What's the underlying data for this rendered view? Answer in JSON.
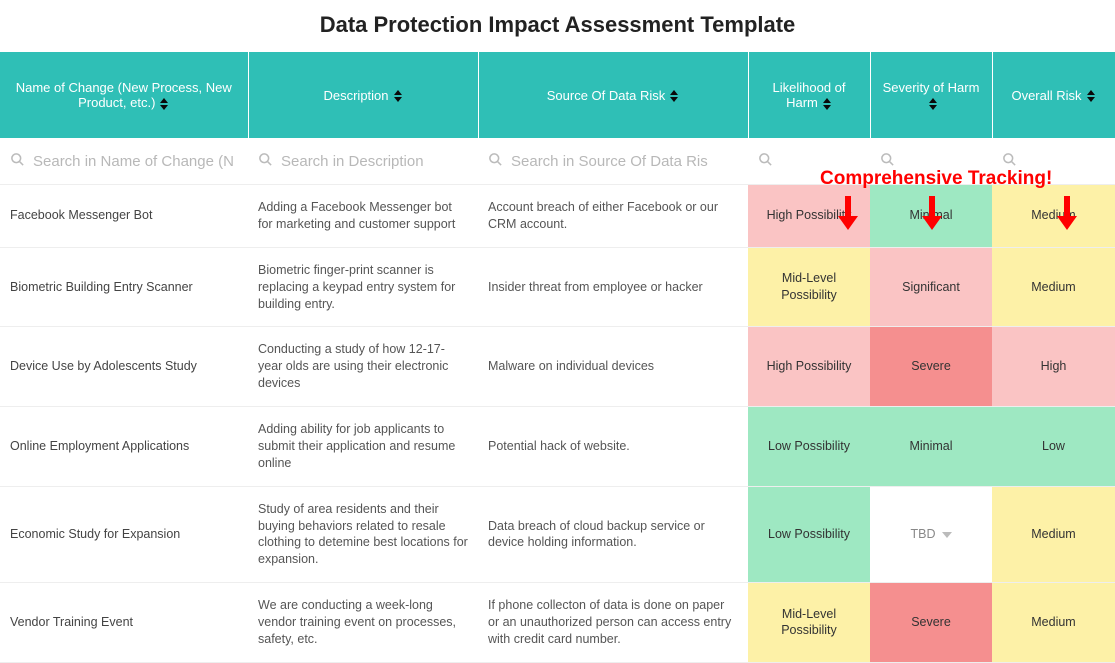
{
  "title": "Data Protection Impact Assessment Template",
  "annotation_label": "Comprehensive Tracking!",
  "columns": {
    "name": "Name of Change (New Process, New Product, etc.)",
    "desc": "Description",
    "src": "Source Of Data Risk",
    "like": "Likelihood of Harm",
    "sev": "Severity of Harm",
    "over": "Overall Risk"
  },
  "search": {
    "name_ph": "Search in Name of Change (N",
    "desc_ph": "Search in Description",
    "src_ph": "Search in Source Of Data Ris"
  },
  "rows": [
    {
      "name": "Facebook Messenger Bot",
      "desc": "Adding a Facebook Messenger bot for marketing and customer support",
      "src": "Account breach of either Facebook or our CRM account.",
      "like": "High Possibility",
      "like_c": "c-pink",
      "sev": "Minimal",
      "sev_c": "c-green",
      "over": "Medium",
      "over_c": "c-yellow"
    },
    {
      "name": "Biometric Building Entry Scanner",
      "desc": "Biometric finger-print scanner is replacing a keypad entry system for building entry.",
      "src": "Insider threat from employee or hacker",
      "like": "Mid-Level Possibility",
      "like_c": "c-yellow",
      "sev": "Significant",
      "sev_c": "c-pink",
      "over": "Medium",
      "over_c": "c-yellow"
    },
    {
      "name": "Device Use by Adolescents Study",
      "desc": "Conducting a study of how 12-17-year olds are using their electronic devices",
      "src": "Malware on individual devices",
      "like": "High Possibility",
      "like_c": "c-pink",
      "sev": "Severe",
      "sev_c": "c-red",
      "over": "High",
      "over_c": "c-pink"
    },
    {
      "name": "Online Employment Applications",
      "desc": "Adding ability for job applicants to submit their application and resume online",
      "src": "Potential hack of website.",
      "like": "Low Possibility",
      "like_c": "c-green",
      "sev": "Minimal",
      "sev_c": "c-green",
      "over": "Low",
      "over_c": "c-green"
    },
    {
      "name": "Economic Study for Expansion",
      "desc": "Study of area residents and their buying behaviors related to resale clothing to detemine best locations for expansion.",
      "src": "Data breach of cloud backup service or device holding information.",
      "like": "Low Possibility",
      "like_c": "c-green",
      "sev": "TBD",
      "sev_c": "c-white",
      "sev_dropdown": true,
      "over": "Medium",
      "over_c": "c-yellow"
    },
    {
      "name": "Vendor Training Event",
      "desc": "We are conducting a week-long vendor training event on processes, safety, etc.",
      "src": "If phone collecton of data is done on paper or an unauthorized person can access entry with credit card number.",
      "like": "Mid-Level Possibility",
      "like_c": "c-yellow",
      "sev": "Severe",
      "sev_c": "c-red",
      "over": "Medium",
      "over_c": "c-yellow"
    }
  ]
}
